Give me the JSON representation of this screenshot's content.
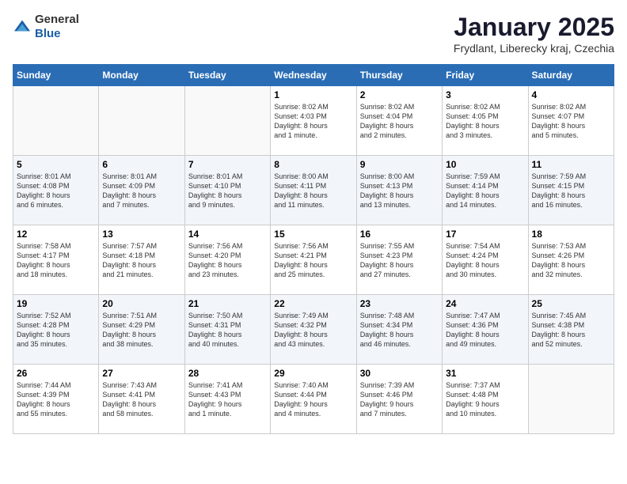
{
  "header": {
    "logo_general": "General",
    "logo_blue": "Blue",
    "month_title": "January 2025",
    "location": "Frydlant, Liberecky kraj, Czechia"
  },
  "days_of_week": [
    "Sunday",
    "Monday",
    "Tuesday",
    "Wednesday",
    "Thursday",
    "Friday",
    "Saturday"
  ],
  "weeks": [
    [
      {
        "day": "",
        "info": ""
      },
      {
        "day": "",
        "info": ""
      },
      {
        "day": "",
        "info": ""
      },
      {
        "day": "1",
        "info": "Sunrise: 8:02 AM\nSunset: 4:03 PM\nDaylight: 8 hours\nand 1 minute."
      },
      {
        "day": "2",
        "info": "Sunrise: 8:02 AM\nSunset: 4:04 PM\nDaylight: 8 hours\nand 2 minutes."
      },
      {
        "day": "3",
        "info": "Sunrise: 8:02 AM\nSunset: 4:05 PM\nDaylight: 8 hours\nand 3 minutes."
      },
      {
        "day": "4",
        "info": "Sunrise: 8:02 AM\nSunset: 4:07 PM\nDaylight: 8 hours\nand 5 minutes."
      }
    ],
    [
      {
        "day": "5",
        "info": "Sunrise: 8:01 AM\nSunset: 4:08 PM\nDaylight: 8 hours\nand 6 minutes."
      },
      {
        "day": "6",
        "info": "Sunrise: 8:01 AM\nSunset: 4:09 PM\nDaylight: 8 hours\nand 7 minutes."
      },
      {
        "day": "7",
        "info": "Sunrise: 8:01 AM\nSunset: 4:10 PM\nDaylight: 8 hours\nand 9 minutes."
      },
      {
        "day": "8",
        "info": "Sunrise: 8:00 AM\nSunset: 4:11 PM\nDaylight: 8 hours\nand 11 minutes."
      },
      {
        "day": "9",
        "info": "Sunrise: 8:00 AM\nSunset: 4:13 PM\nDaylight: 8 hours\nand 13 minutes."
      },
      {
        "day": "10",
        "info": "Sunrise: 7:59 AM\nSunset: 4:14 PM\nDaylight: 8 hours\nand 14 minutes."
      },
      {
        "day": "11",
        "info": "Sunrise: 7:59 AM\nSunset: 4:15 PM\nDaylight: 8 hours\nand 16 minutes."
      }
    ],
    [
      {
        "day": "12",
        "info": "Sunrise: 7:58 AM\nSunset: 4:17 PM\nDaylight: 8 hours\nand 18 minutes."
      },
      {
        "day": "13",
        "info": "Sunrise: 7:57 AM\nSunset: 4:18 PM\nDaylight: 8 hours\nand 21 minutes."
      },
      {
        "day": "14",
        "info": "Sunrise: 7:56 AM\nSunset: 4:20 PM\nDaylight: 8 hours\nand 23 minutes."
      },
      {
        "day": "15",
        "info": "Sunrise: 7:56 AM\nSunset: 4:21 PM\nDaylight: 8 hours\nand 25 minutes."
      },
      {
        "day": "16",
        "info": "Sunrise: 7:55 AM\nSunset: 4:23 PM\nDaylight: 8 hours\nand 27 minutes."
      },
      {
        "day": "17",
        "info": "Sunrise: 7:54 AM\nSunset: 4:24 PM\nDaylight: 8 hours\nand 30 minutes."
      },
      {
        "day": "18",
        "info": "Sunrise: 7:53 AM\nSunset: 4:26 PM\nDaylight: 8 hours\nand 32 minutes."
      }
    ],
    [
      {
        "day": "19",
        "info": "Sunrise: 7:52 AM\nSunset: 4:28 PM\nDaylight: 8 hours\nand 35 minutes."
      },
      {
        "day": "20",
        "info": "Sunrise: 7:51 AM\nSunset: 4:29 PM\nDaylight: 8 hours\nand 38 minutes."
      },
      {
        "day": "21",
        "info": "Sunrise: 7:50 AM\nSunset: 4:31 PM\nDaylight: 8 hours\nand 40 minutes."
      },
      {
        "day": "22",
        "info": "Sunrise: 7:49 AM\nSunset: 4:32 PM\nDaylight: 8 hours\nand 43 minutes."
      },
      {
        "day": "23",
        "info": "Sunrise: 7:48 AM\nSunset: 4:34 PM\nDaylight: 8 hours\nand 46 minutes."
      },
      {
        "day": "24",
        "info": "Sunrise: 7:47 AM\nSunset: 4:36 PM\nDaylight: 8 hours\nand 49 minutes."
      },
      {
        "day": "25",
        "info": "Sunrise: 7:45 AM\nSunset: 4:38 PM\nDaylight: 8 hours\nand 52 minutes."
      }
    ],
    [
      {
        "day": "26",
        "info": "Sunrise: 7:44 AM\nSunset: 4:39 PM\nDaylight: 8 hours\nand 55 minutes."
      },
      {
        "day": "27",
        "info": "Sunrise: 7:43 AM\nSunset: 4:41 PM\nDaylight: 8 hours\nand 58 minutes."
      },
      {
        "day": "28",
        "info": "Sunrise: 7:41 AM\nSunset: 4:43 PM\nDaylight: 9 hours\nand 1 minute."
      },
      {
        "day": "29",
        "info": "Sunrise: 7:40 AM\nSunset: 4:44 PM\nDaylight: 9 hours\nand 4 minutes."
      },
      {
        "day": "30",
        "info": "Sunrise: 7:39 AM\nSunset: 4:46 PM\nDaylight: 9 hours\nand 7 minutes."
      },
      {
        "day": "31",
        "info": "Sunrise: 7:37 AM\nSunset: 4:48 PM\nDaylight: 9 hours\nand 10 minutes."
      },
      {
        "day": "",
        "info": ""
      }
    ]
  ]
}
